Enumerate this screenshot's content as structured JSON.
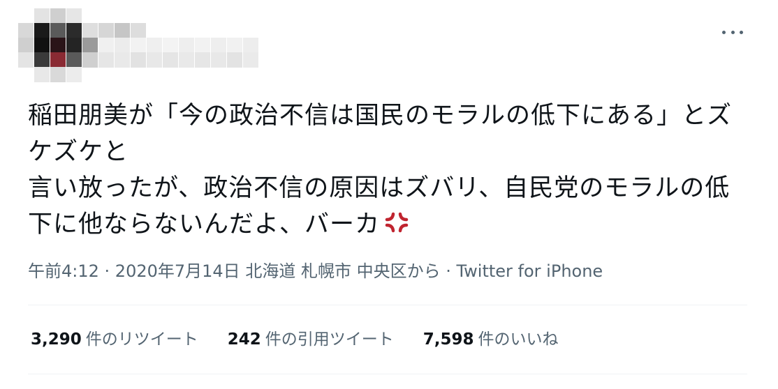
{
  "author": {
    "avatar_obscured": true
  },
  "menu": {
    "more_icon": "more-horizontal-icon"
  },
  "tweet": {
    "text": "稲田朋美が「今の政治不信は国民のモラルの低下にある」とズケズケと\n言い放ったが、政治不信の原因はズバリ、自民党のモラルの低下に他ならないんだよ、バーカ",
    "emoji": "anger-symbol-icon",
    "emoji_color": "#c0242f"
  },
  "meta": {
    "time": "午前4:12",
    "sep1": " · ",
    "date": "2020年7月14日",
    "space": " ",
    "location": "北海道 札幌市 中央区",
    "from": "から",
    "sep2": " · ",
    "source": "Twitter for iPhone"
  },
  "stats": [
    {
      "count": "3,290",
      "label": "件のリツイート"
    },
    {
      "count": "242",
      "label": "件の引用ツイート"
    },
    {
      "count": "7,598",
      "label": "件のいいね"
    }
  ],
  "colors": {
    "text": "#0f1419",
    "secondary": "#536471",
    "divider": "#eff3f4"
  }
}
